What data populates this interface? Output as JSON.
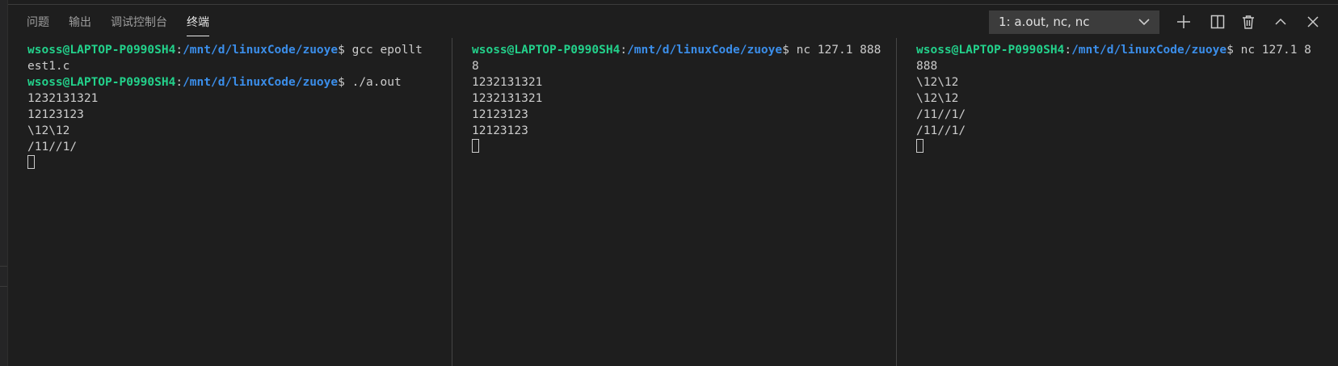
{
  "panel": {
    "tabs": [
      {
        "label": "问题",
        "active": false
      },
      {
        "label": "输出",
        "active": false
      },
      {
        "label": "调试控制台",
        "active": false
      },
      {
        "label": "终端",
        "active": true
      }
    ],
    "terminal_selector": {
      "value": "1: a.out, nc, nc",
      "icon": "chevron-down-icon"
    },
    "actions": [
      {
        "name": "new-terminal-button",
        "icon": "plus-icon"
      },
      {
        "name": "split-terminal-button",
        "icon": "split-icon"
      },
      {
        "name": "kill-terminal-button",
        "icon": "trash-icon"
      },
      {
        "name": "maximize-panel-button",
        "icon": "chevron-up-icon"
      },
      {
        "name": "close-panel-button",
        "icon": "close-icon"
      }
    ]
  },
  "terminals": [
    {
      "lines": [
        {
          "user": "wsoss@LAPTOP-P0990SH4",
          "sep": ":",
          "path": "/mnt/d/linuxCode/zuoye",
          "cmd": "$ gcc epollt"
        },
        {
          "text": "est1.c"
        },
        {
          "user": "wsoss@LAPTOP-P0990SH4",
          "sep": ":",
          "path": "/mnt/d/linuxCode/zuoye",
          "cmd": "$ ./a.out"
        },
        {
          "text": "1232131321"
        },
        {
          "text": "12123123"
        },
        {
          "text": "\\12\\12"
        },
        {
          "text": "/11//1/"
        }
      ]
    },
    {
      "lines": [
        {
          "user": "wsoss@LAPTOP-P0990SH4",
          "sep": ":",
          "path": "/mnt/d/linuxCode/zuoye",
          "cmd": "$ nc 127.1 888"
        },
        {
          "text": "8"
        },
        {
          "text": "1232131321"
        },
        {
          "text": "1232131321"
        },
        {
          "text": "12123123"
        },
        {
          "text": "12123123"
        }
      ]
    },
    {
      "lines": [
        {
          "user": "wsoss@LAPTOP-P0990SH4",
          "sep": ":",
          "path": "/mnt/d/linuxCode/zuoye",
          "cmd": "$ nc 127.1 8"
        },
        {
          "text": "888"
        },
        {
          "text": "\\12\\12"
        },
        {
          "text": "\\12\\12"
        },
        {
          "text": "/11//1/"
        },
        {
          "text": "/11//1/"
        }
      ]
    }
  ],
  "colors": {
    "background": "#1e1e1e",
    "prompt_user": "#23d18b",
    "prompt_path": "#3b8eea",
    "text": "#cccccc"
  }
}
